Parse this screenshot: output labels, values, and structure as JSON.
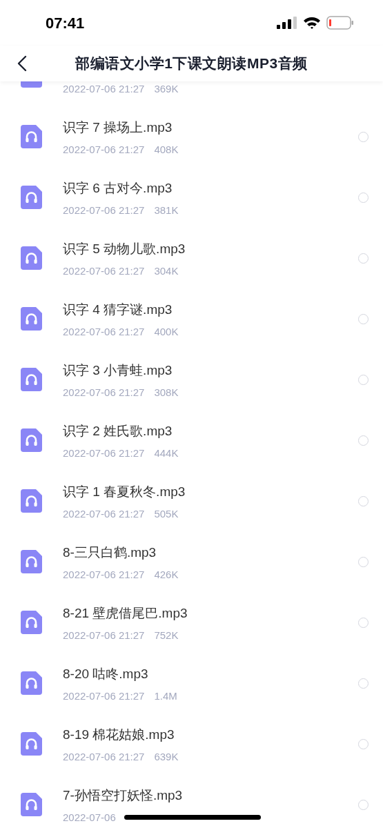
{
  "status_bar": {
    "time": "07:41"
  },
  "header": {
    "title": "部编语文小学1下课文朗读MP3音频"
  },
  "files": [
    {
      "date": "2022-07-06 21:27",
      "size": "369K"
    },
    {
      "name": "识字 7 操场上.mp3",
      "date": "2022-07-06 21:27",
      "size": "408K",
      "selected": false
    },
    {
      "name": "识字 6 古对今.mp3",
      "date": "2022-07-06 21:27",
      "size": "381K",
      "selected": false
    },
    {
      "name": "识字 5 动物儿歌.mp3",
      "date": "2022-07-06 21:27",
      "size": "304K",
      "selected": false
    },
    {
      "name": "识字 4 猜字谜.mp3",
      "date": "2022-07-06 21:27",
      "size": "400K",
      "selected": false
    },
    {
      "name": "识字 3 小青蛙.mp3",
      "date": "2022-07-06 21:27",
      "size": "308K",
      "selected": false
    },
    {
      "name": "识字 2 姓氏歌.mp3",
      "date": "2022-07-06 21:27",
      "size": "444K",
      "selected": false
    },
    {
      "name": "识字 1 春夏秋冬.mp3",
      "date": "2022-07-06 21:27",
      "size": "505K",
      "selected": false
    },
    {
      "name": "8-三只白鹤.mp3",
      "date": "2022-07-06 21:27",
      "size": "426K",
      "selected": false
    },
    {
      "name": "8-21 壁虎借尾巴.mp3",
      "date": "2022-07-06 21:27",
      "size": "752K",
      "selected": false
    },
    {
      "name": "8-20 咕咚.mp3",
      "date": "2022-07-06 21:27",
      "size": "1.4M",
      "selected": false
    },
    {
      "name": "8-19 棉花姑娘.mp3",
      "date": "2022-07-06 21:27",
      "size": "639K",
      "selected": false
    },
    {
      "name": "7-孙悟空打妖怪.mp3",
      "date": "2022-07-06",
      "selected": false
    }
  ]
}
